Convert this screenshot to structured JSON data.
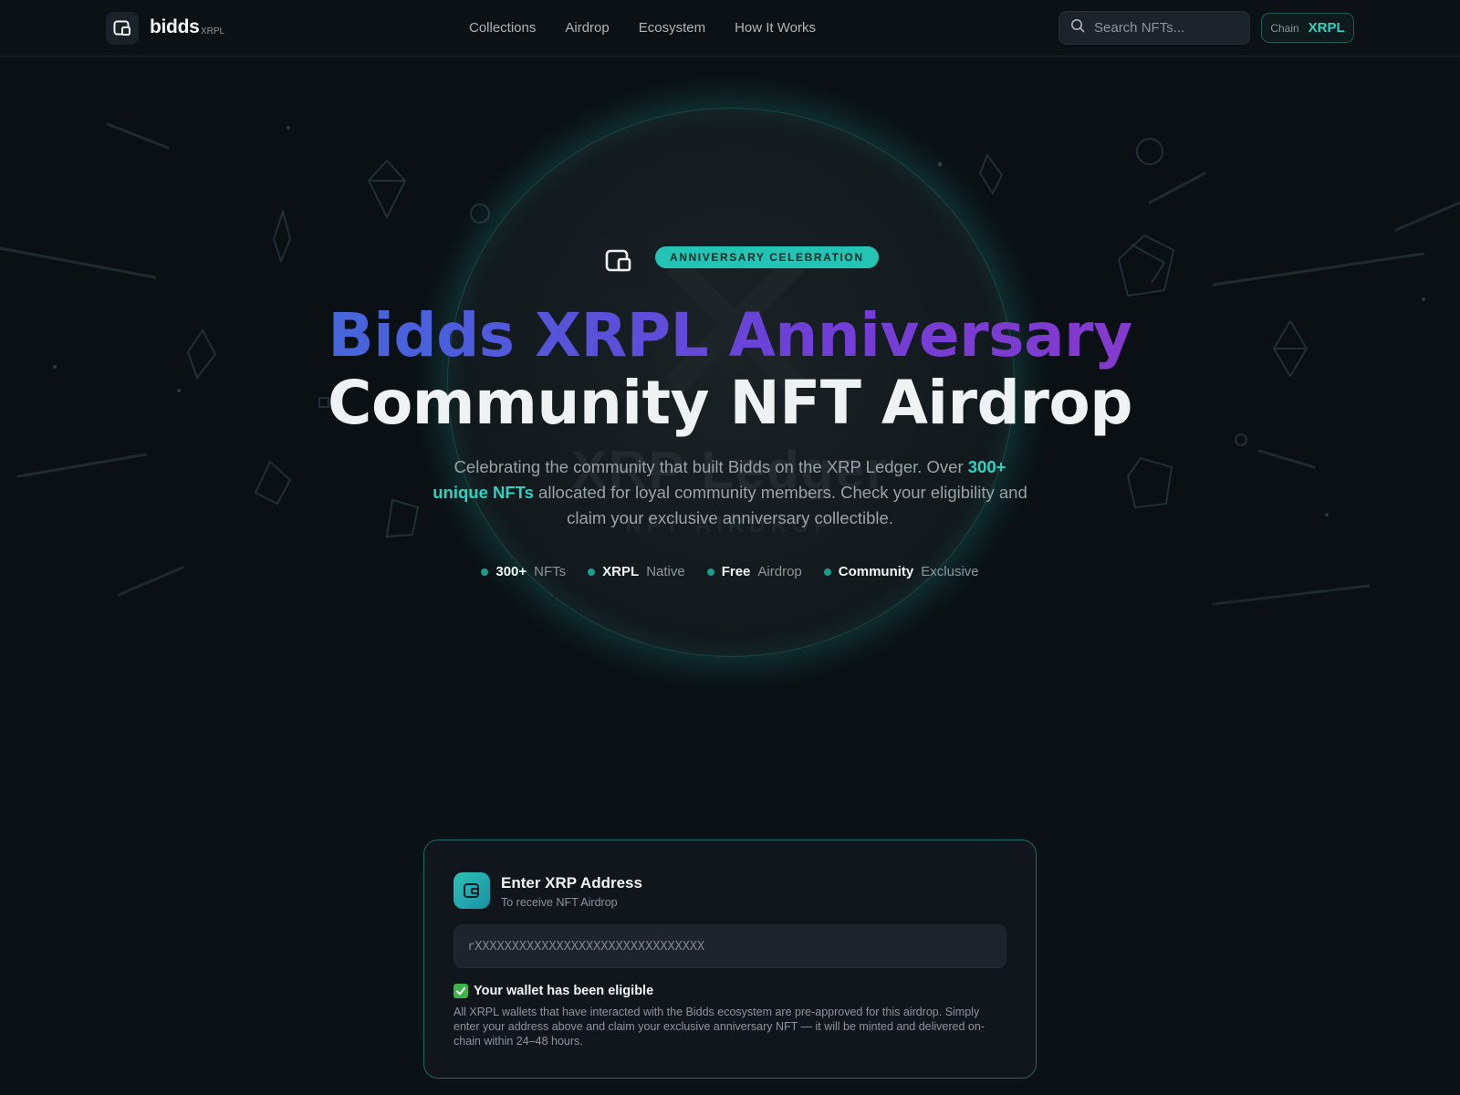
{
  "nav": {
    "brand": "bidds",
    "brand_sub": "XRPL",
    "links": [
      "Collections",
      "Airdrop",
      "Ecosystem",
      "How It Works"
    ],
    "search_placeholder": "Search NFTs...",
    "chain_label": "Chain",
    "chain_value": "XRPL"
  },
  "hero": {
    "badge": "ANNIVERSARY CELEBRATION",
    "title_line1_parts": [
      "Bidds",
      "XRPL",
      "Anniversary"
    ],
    "title_line2": "Community NFT Airdrop",
    "watermark_line1": "XRP Ledger",
    "watermark_line2": "NFT AIRDROP",
    "subtitle_pre": "Celebrating the community that built Bidds on the XRP Ledger. Over ",
    "subtitle_highlight": "300+ unique NFTs",
    "subtitle_post": " allocated for loyal community members. Check your eligibility and claim your exclusive anniversary collectible.",
    "stats": [
      {
        "bold": "300+",
        "rest": "NFTs"
      },
      {
        "bold": "XRPL",
        "rest": "Native"
      },
      {
        "bold": "Free",
        "rest": "Airdrop"
      },
      {
        "bold": "Community",
        "rest": "Exclusive"
      }
    ]
  },
  "card": {
    "title": "Enter XRP Address",
    "subtitle": "To receive NFT Airdrop",
    "address_placeholder": "rXXXXXXXXXXXXXXXXXXXXXXXXXXXXXXX",
    "eligible_text": "Your wallet has been eligible",
    "eligible_desc": "All XRPL wallets that have interacted with the Bidds ecosystem are pre-approved for this airdrop. Simply enter your address above and claim your exclusive anniversary NFT — it will be minted and delivered on-chain within 24–48 hours."
  },
  "colors": {
    "accent": "#2ed3c1",
    "background": "#0b1014",
    "card_border": "#1f6a63",
    "gradient_start": "#3a7fd0",
    "gradient_end": "#9a35c0"
  },
  "icons": [
    "wallet-icon",
    "search-icon",
    "check-icon"
  ]
}
